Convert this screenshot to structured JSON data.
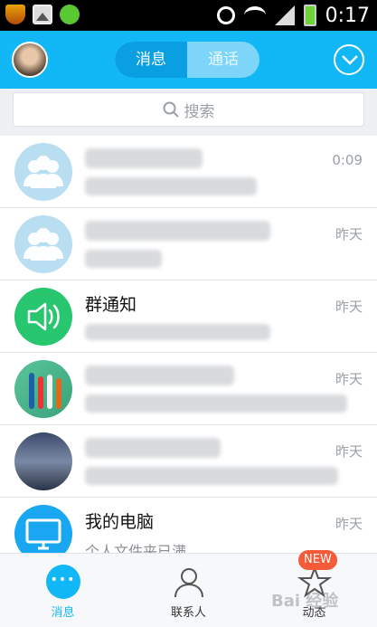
{
  "status_bar": {
    "time": "0:17"
  },
  "header": {
    "tabs": [
      {
        "label": "消息",
        "active": true
      },
      {
        "label": "通话",
        "active": false
      }
    ]
  },
  "search": {
    "placeholder": "搜索"
  },
  "conversations": [
    {
      "title": "",
      "preview": "",
      "time": "0:09",
      "avatar": "group-avatar"
    },
    {
      "title": "",
      "preview": "",
      "time": "昨天",
      "avatar": "group-avatar"
    },
    {
      "title": "群通知",
      "preview": "",
      "time": "昨天",
      "avatar": "speaker-icon"
    },
    {
      "title": "",
      "preview": "",
      "time": "昨天",
      "avatar": "toothbrush-photo"
    },
    {
      "title": "",
      "preview": "",
      "time": "昨天",
      "avatar": "city-photo"
    },
    {
      "title": "我的电脑",
      "preview": "个人文件夹已满",
      "time": "昨天",
      "avatar": "monitor-icon"
    }
  ],
  "tabbar": {
    "items": [
      {
        "label": "消息",
        "icon": "chat-bubble-icon",
        "active": true
      },
      {
        "label": "联系人",
        "icon": "contacts-icon",
        "active": false
      },
      {
        "label": "动态",
        "icon": "star-icon",
        "active": false,
        "badge": "NEW"
      }
    ]
  },
  "watermark": "Bai 经验",
  "colors": {
    "header": "#12b7f5",
    "accent": "#12b7f5",
    "badge": "#f55a39"
  }
}
